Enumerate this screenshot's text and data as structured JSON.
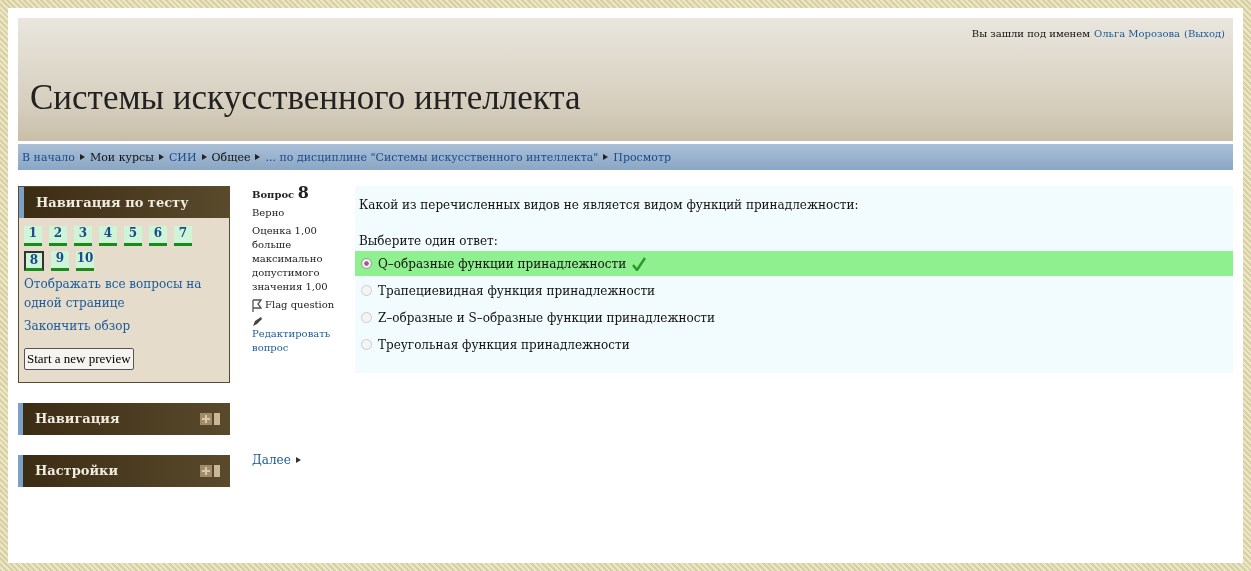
{
  "header": {
    "login_prefix": "Вы зашли под именем",
    "user": "Ольга Морозова",
    "logout": "(Выход)",
    "title": "Системы искусственного интеллекта"
  },
  "breadcrumb": [
    {
      "label": "В начало",
      "kind": "link"
    },
    {
      "label": "Мои курсы",
      "kind": "text"
    },
    {
      "label": "СИИ",
      "kind": "link"
    },
    {
      "label": "Общее",
      "kind": "text"
    },
    {
      "label": "... по дисциплине \"Системы искусственного интеллекта\"",
      "kind": "link"
    },
    {
      "label": "Просмотр",
      "kind": "link"
    }
  ],
  "quiz_nav": {
    "title": "Навигация по тесту",
    "questions": [
      {
        "number": "1",
        "selected": false
      },
      {
        "number": "2",
        "selected": false
      },
      {
        "number": "3",
        "selected": false
      },
      {
        "number": "4",
        "selected": false
      },
      {
        "number": "5",
        "selected": false
      },
      {
        "number": "6",
        "selected": false
      },
      {
        "number": "7",
        "selected": false
      },
      {
        "number": "8",
        "selected": true
      },
      {
        "number": "9",
        "selected": false
      },
      {
        "number": "10",
        "selected": false
      }
    ],
    "links": [
      "Отображать все вопросы на одной странице",
      "Закончить обзор"
    ],
    "button": "Start a new preview"
  },
  "blocks": [
    {
      "title": "Навигация"
    },
    {
      "title": "Настройки"
    }
  ],
  "info": {
    "label": "Вопрос",
    "number": "8",
    "state": "Верно",
    "grade": "Оценка 1,00 больше максимально допустимого значения 1,00",
    "flag": "Flag question",
    "edit": "Редактировать вопрос"
  },
  "question": {
    "text": "Какой из перечисленных видов не является видом функций принадлежности:",
    "prompt": "Выберите один ответ:",
    "answers": [
      {
        "text": "Q–образные функции принадлежности",
        "selected": true,
        "correct": true
      },
      {
        "text": "Трапециевидная функция принадлежности",
        "selected": false,
        "correct": false
      },
      {
        "text": "Z–образные и S–образные функции принадлежности",
        "selected": false,
        "correct": false
      },
      {
        "text": "Треугольная функция принадлежности",
        "selected": false,
        "correct": false
      }
    ]
  },
  "next": "Далее"
}
